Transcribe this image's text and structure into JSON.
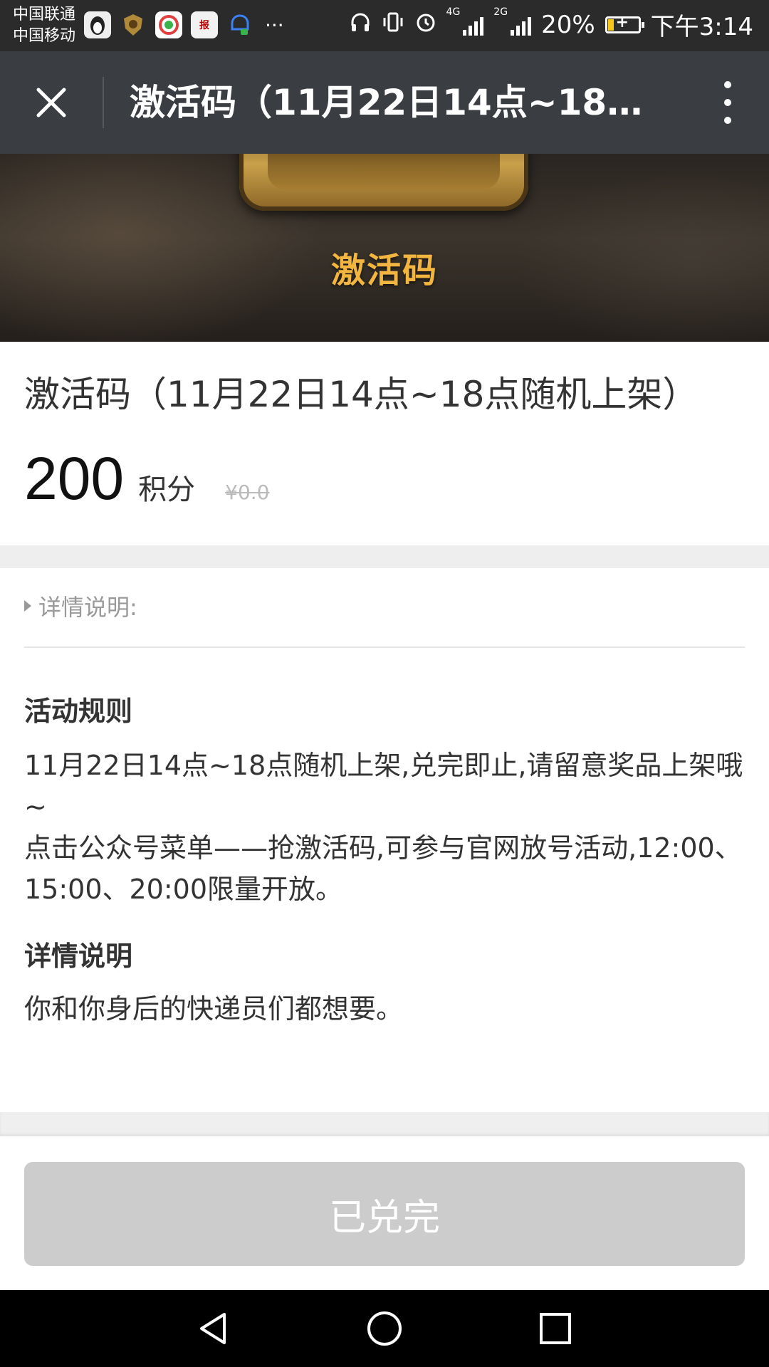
{
  "status_bar": {
    "carrier_1": "中国联通",
    "carrier_2": "中国移动",
    "notification_icons": [
      "penguin-app-icon",
      "shield-app-icon",
      "browser-app-icon",
      "news-app-icon",
      "chat-app-icon"
    ],
    "notif_news_text": "报",
    "more": "···",
    "network_4g": "4G",
    "network_2g": "2G",
    "battery": "20%",
    "battery_level": 0.2,
    "time": "下午3:14"
  },
  "title_bar": {
    "title": "激活码（11月22日14点~18点...",
    "close_icon": "close-icon",
    "menu_icon": "more-vertical-icon"
  },
  "banner": {
    "label": "激活码"
  },
  "product": {
    "name": "激活码（11月22日14点~18点随机上架）",
    "points": "200",
    "points_unit": "积分",
    "original_price": "¥0.0"
  },
  "details": {
    "header": "详情说明:",
    "rules_title": "活动规则",
    "rules_text_1": "11月22日14点~18点随机上架,兑完即止,请留意奖品上架哦~",
    "rules_text_2": "点击公众号菜单——抢激活码,可参与官网放号活动,12:00、15:00、20:00限量开放。",
    "desc_title": "详情说明",
    "desc_text": "你和你身后的快递员们都想要。"
  },
  "action": {
    "button_label": "已兑完"
  },
  "colors": {
    "title_bar_bg": "#3a3d42",
    "status_bar_bg": "#2b2b2b",
    "banner_label": "#f2b640",
    "button_disabled": "#cccccc"
  }
}
